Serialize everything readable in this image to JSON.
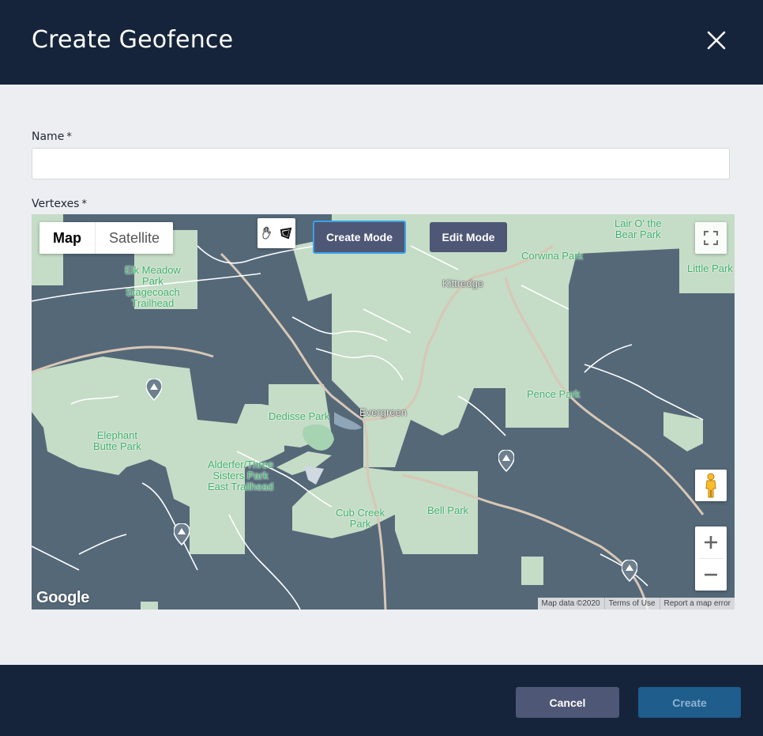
{
  "dialog": {
    "title": "Create Geofence",
    "close_icon": "close-icon"
  },
  "form": {
    "name_label": "Name",
    "name_required": "*",
    "name_value": "",
    "vertexes_label": "Vertexes",
    "vertexes_required": "*"
  },
  "map": {
    "map_type_options": [
      "Map",
      "Satellite"
    ],
    "map_type_selected": "Map",
    "draw_tools": [
      "hand-icon",
      "polygon-icon"
    ],
    "create_mode_label": "Create Mode",
    "edit_mode_label": "Edit Mode",
    "google_logo": "Google",
    "attribution": [
      "Map data ©2020",
      "Terms of Use",
      "Report a map error"
    ],
    "place_labels": {
      "elk_meadow": "Elk Meadow\nPark\nStagecoach\nTrailhead",
      "lair": "Lair O' the\nBear Park",
      "corwina": "Corwina Park",
      "little_park": "Little Park",
      "kittredge": "Kittredge",
      "dedisse": "Dedisse Park",
      "evergreen": "Evergreen",
      "pence": "Pence Park",
      "elephant_butte": "Elephant\nButte Park",
      "alderfer": "Alderfer/Three\nSisters Park\nEast Trailhead",
      "cub_creek": "Cub Creek\nPark",
      "bell_park": "Bell Park"
    },
    "colors": {
      "land": "#546878",
      "park": "#c5dcc6",
      "road": "#ffffff",
      "major_road": "#d8c7b5"
    }
  },
  "footer": {
    "cancel_label": "Cancel",
    "create_label": "Create"
  }
}
